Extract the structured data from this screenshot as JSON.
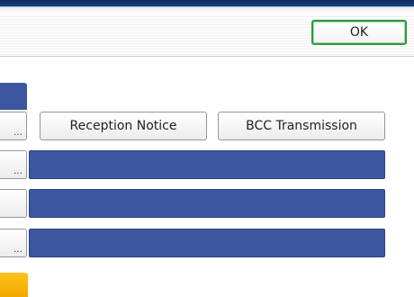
{
  "toolbar": {
    "ok_label": "OK"
  },
  "options": {
    "reception_notice_label": "Reception Notice",
    "bcc_transmission_label": "BCC Transmission"
  },
  "icons": {
    "ellipsis": "…"
  },
  "colors": {
    "field_blue": "#3d56a0",
    "ok_border_green": "#2f9a3f",
    "accent_orange": "#f2a900"
  }
}
